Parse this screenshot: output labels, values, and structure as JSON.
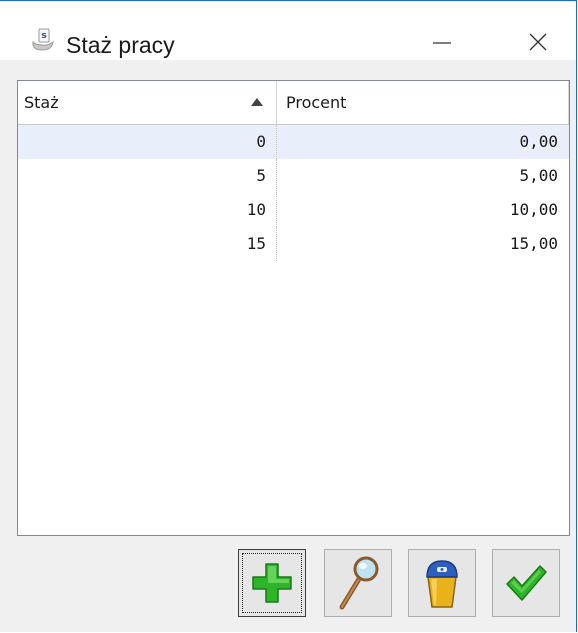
{
  "window": {
    "title": "Staż pracy",
    "minimize_label": "",
    "close_label": ""
  },
  "grid": {
    "columns": [
      {
        "label": "Staż",
        "sort": "ascending"
      },
      {
        "label": "Procent"
      }
    ],
    "rows": [
      {
        "staz": "0",
        "procent": "0,00",
        "selected": true
      },
      {
        "staz": "5",
        "procent": "5,00"
      },
      {
        "staz": "10",
        "procent": "10,00"
      },
      {
        "staz": "15",
        "procent": "15,00"
      }
    ]
  },
  "buttons": [
    {
      "name": "add-button",
      "icon": "plus-icon",
      "focused": true
    },
    {
      "name": "view-button",
      "icon": "magnifier-icon"
    },
    {
      "name": "delete-button",
      "icon": "trash-bin-icon"
    },
    {
      "name": "ok-button",
      "icon": "checkmark-icon"
    }
  ]
}
